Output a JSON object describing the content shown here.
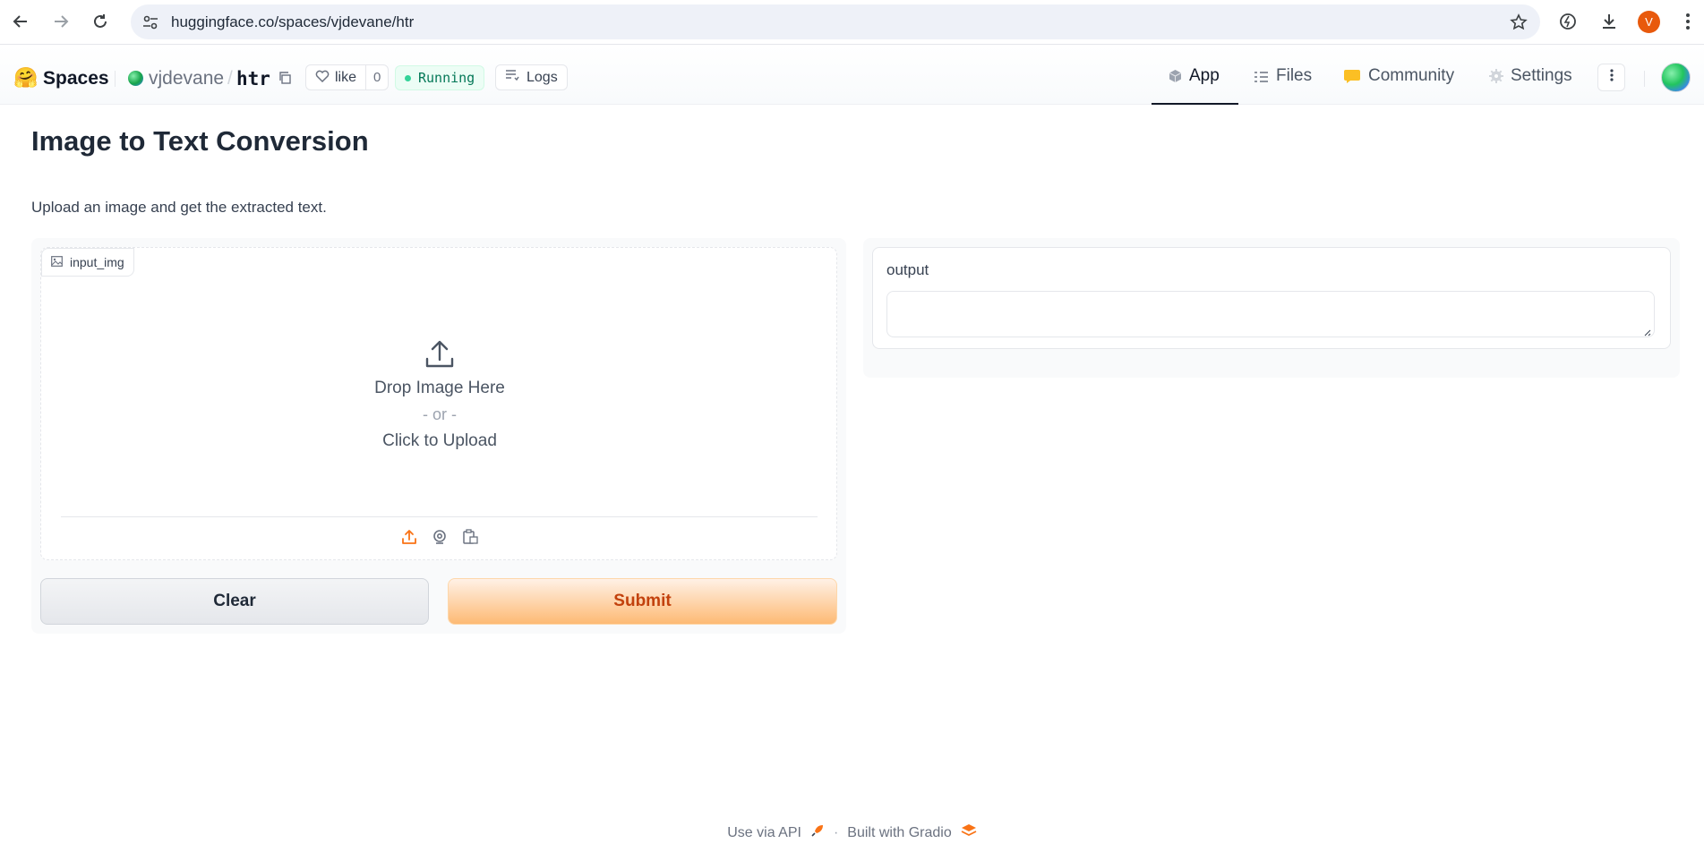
{
  "browser": {
    "url": "huggingface.co/spaces/vjdevane/htr",
    "profile_initial": "V"
  },
  "header": {
    "brand": "Spaces",
    "owner": "vjdevane",
    "slash": "/",
    "space_name": "htr",
    "like_label": "like",
    "like_count": "0",
    "status": "Running",
    "logs_label": "Logs",
    "tabs": [
      {
        "label": "App",
        "icon": "cube-icon",
        "active": true
      },
      {
        "label": "Files",
        "icon": "files-icon",
        "active": false
      },
      {
        "label": "Community",
        "icon": "community-icon",
        "active": false
      },
      {
        "label": "Settings",
        "icon": "gear-icon",
        "active": false
      }
    ]
  },
  "app": {
    "title": "Image to Text Conversion",
    "description": "Upload an image and get the extracted text.",
    "input_label": "input_img",
    "drop_text": "Drop Image Here",
    "or_text": "- or -",
    "click_text": "Click to Upload",
    "clear_label": "Clear",
    "submit_label": "Submit",
    "output_label": "output",
    "output_value": ""
  },
  "footer": {
    "api_label": "Use via API",
    "separator": "·",
    "built_label": "Built with Gradio"
  },
  "colors": {
    "accent": "#f97316",
    "running": "#047857",
    "profile": "#e8590c"
  }
}
